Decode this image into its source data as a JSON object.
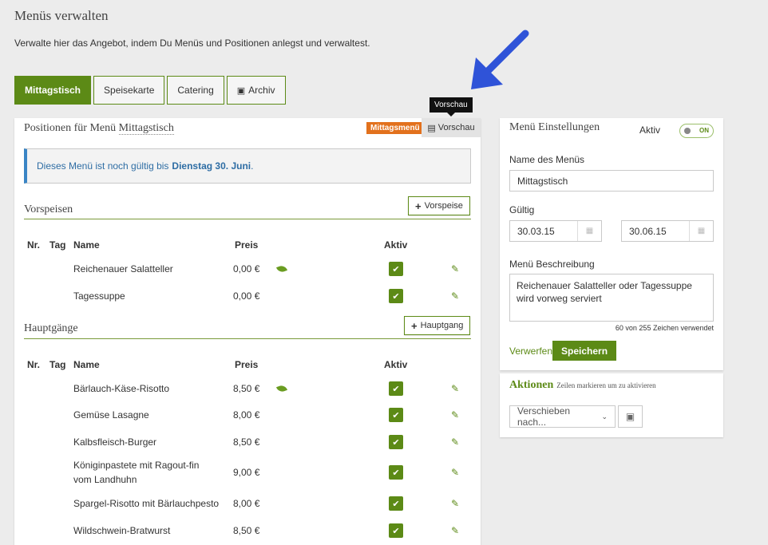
{
  "header": {
    "title": "Menüs verwalten",
    "subtitle": "Verwalte hier das Angebot, indem Du Menüs und Positionen anlegst und verwaltest."
  },
  "tabs": [
    {
      "label": "Mittagstisch"
    },
    {
      "label": "Speisekarte"
    },
    {
      "label": "Catering"
    },
    {
      "label": "Archiv",
      "icon": "archive-icon"
    }
  ],
  "positions": {
    "title_prefix": "Positionen für Menü",
    "menu_name": "Mittagstisch",
    "badge": "Mittagsmenü",
    "preview_label": "Vorschau",
    "tooltip": "Vorschau",
    "info_text": "Dieses Menü ist noch gültig bis",
    "info_date": "Dienstag 30. Juni",
    "info_end": "."
  },
  "columns": {
    "nr": "Nr.",
    "tag": "Tag",
    "name": "Name",
    "price": "Preis",
    "active": "Aktiv"
  },
  "sections": [
    {
      "title": "Vorspeisen",
      "add_label": "Vorspeise",
      "items": [
        {
          "name": "Reichenauer Salatteller",
          "price": "0,00 €",
          "veg": true,
          "active": true
        },
        {
          "name": "Tagessuppe",
          "price": "0,00 €",
          "veg": false,
          "active": true
        }
      ]
    },
    {
      "title": "Hauptgänge",
      "add_label": "Hauptgang",
      "items": [
        {
          "name": "Bärlauch-Käse-Risotto",
          "price": "8,50 €",
          "veg": true,
          "active": true
        },
        {
          "name": "Gemüse Lasagne",
          "price": "8,00 €",
          "veg": false,
          "active": true
        },
        {
          "name": "Kalbsfleisch-Burger",
          "price": "8,50 €",
          "veg": false,
          "active": true
        },
        {
          "name": "Königinpastete mit Ragout-fin",
          "name2": "vom Landhuhn",
          "price": "9,00 €",
          "veg": false,
          "active": true
        },
        {
          "name": "Spargel-Risotto mit Bärlauchpesto",
          "price": "8,00 €",
          "veg": false,
          "active": true
        },
        {
          "name": "Wildschwein-Bratwurst",
          "price": "8,50 €",
          "veg": false,
          "active": true
        }
      ]
    }
  ],
  "settings": {
    "title": "Menü Einstellungen",
    "active_label": "Aktiv",
    "toggle_label": "ON",
    "name_label": "Name des Menüs",
    "name_value": "Mittagstisch",
    "valid_label": "Gültig",
    "valid_from": "30.03.15",
    "valid_to": "30.06.15",
    "desc_label": "Menü Beschreibung",
    "desc_value": "Reichenauer Salatteller oder Tagessuppe wird vorweg serviert",
    "counter": "60 von 255 Zeichen verwendet",
    "discard": "Verwerfen",
    "save": "Speichern"
  },
  "actions": {
    "title": "Aktionen",
    "subtitle": "Zeilen markieren um zu aktivieren",
    "move_label": "Verschieben nach..."
  },
  "colors": {
    "accent": "#5c8a16",
    "badge": "#e2711d",
    "info": "#3a85c5",
    "arrow": "#2f53d8"
  }
}
